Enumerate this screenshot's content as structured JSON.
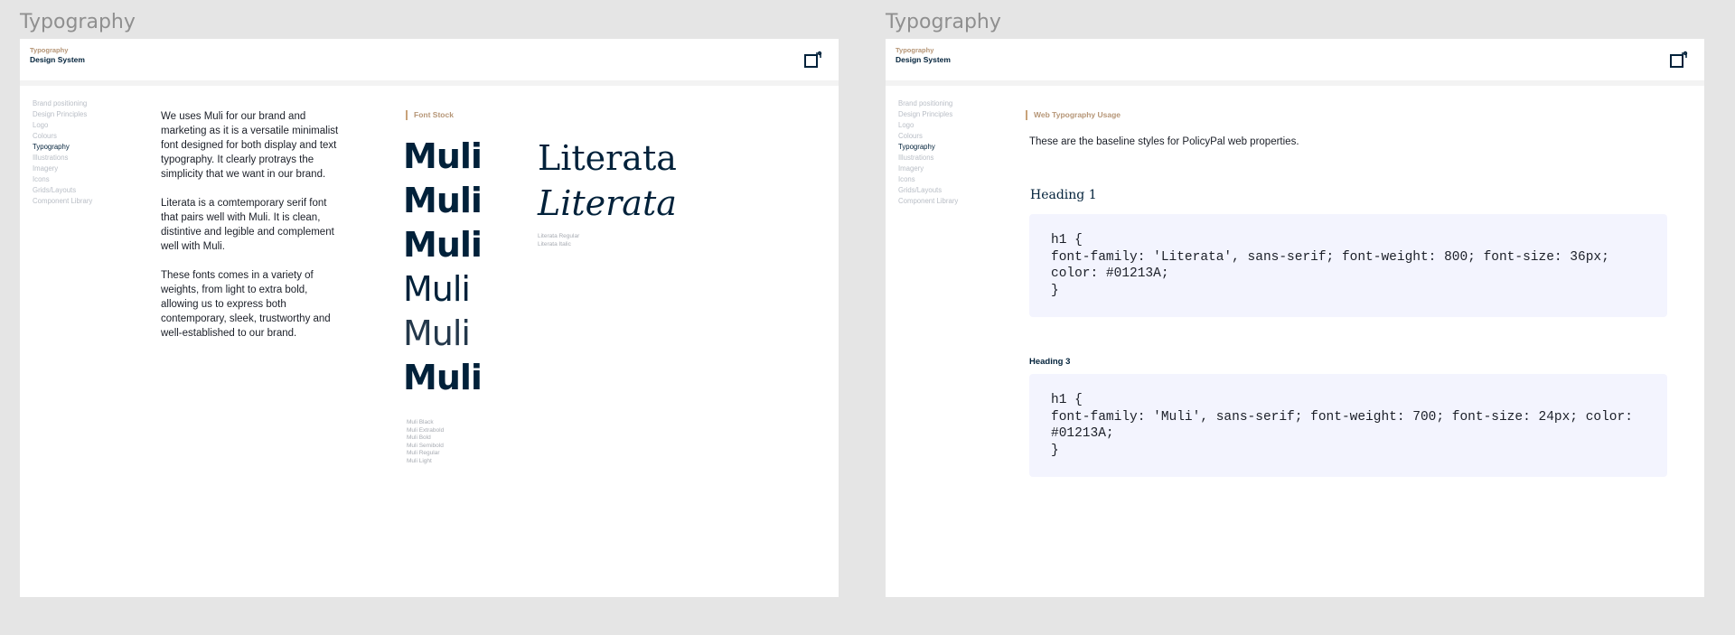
{
  "frames": [
    {
      "frame_title": "Typography",
      "header": {
        "crumb": "Typography",
        "title": "Design System"
      },
      "nav": [
        {
          "label": "Brand positioning",
          "active": false
        },
        {
          "label": "Design Principles",
          "active": false
        },
        {
          "label": "Logo",
          "active": false
        },
        {
          "label": "Colours",
          "active": false
        },
        {
          "label": "Typography",
          "active": true
        },
        {
          "label": "Illustrations",
          "active": false
        },
        {
          "label": "Imagery",
          "active": false
        },
        {
          "label": "Icons",
          "active": false
        },
        {
          "label": "Grids/Layouts",
          "active": false
        },
        {
          "label": "Component Library",
          "active": false
        }
      ],
      "intro": [
        "We uses Muli for our brand and marketing as it is a versatile minimalist font designed for both display and text typography. It clearly protrays the simplicity that we want in our brand.",
        "Literata is a comtemporary serif font that pairs well with Muli. It is clean, distintive and legible and complement well with Muli.",
        "These fonts comes in a variety of weights, from light to extra bold, allowing us to express both contemporary, sleek, trustworthy and well-established to our brand."
      ],
      "section_label": "Font Stock",
      "muli_samples": [
        "Muli",
        "Muli",
        "Muli",
        "Muli",
        "Muli",
        "Muli"
      ],
      "literata_samples": [
        "Literata",
        "Literata"
      ],
      "literata_names": [
        "Literata Regular",
        "Literata Italic"
      ],
      "muli_names": [
        "Muli Black",
        "Muli Extrabold",
        "Muli Bold",
        "Muli Semibold",
        "Muli Regular",
        "Muli Light"
      ]
    },
    {
      "frame_title": "Typography",
      "header": {
        "crumb": "Typography",
        "title": "Design System"
      },
      "nav": [
        {
          "label": "Brand positioning",
          "active": false
        },
        {
          "label": "Design Principles",
          "active": false
        },
        {
          "label": "Logo",
          "active": false
        },
        {
          "label": "Colours",
          "active": false
        },
        {
          "label": "Typography",
          "active": true
        },
        {
          "label": "Illustrations",
          "active": false
        },
        {
          "label": "Imagery",
          "active": false
        },
        {
          "label": "Icons",
          "active": false
        },
        {
          "label": "Grids/Layouts",
          "active": false
        },
        {
          "label": "Component Library",
          "active": false
        }
      ],
      "section_label": "Web Typography Usage",
      "description": "These are the baseline styles for PolicyPal web properties.",
      "heading1_label": "Heading 1",
      "heading1_code": "h1 {\nfont-family: 'Literata', sans-serif; font-weight: 800; font-size: 36px; color: #01213A;\n}",
      "heading3_label": "Heading 3",
      "heading3_code": "h1 {\nfont-family: 'Muli', sans-serif; font-weight: 700; font-size: 24px; color: #01213A;\n}"
    }
  ],
  "colors": {
    "navy": "#01213A",
    "accent": "#b69677",
    "nav_inactive": "#b9bec6",
    "code_bg": "#f3f4fe",
    "canvas": "#e5e5e5"
  },
  "icons": {
    "header_action": "external-link-icon"
  }
}
